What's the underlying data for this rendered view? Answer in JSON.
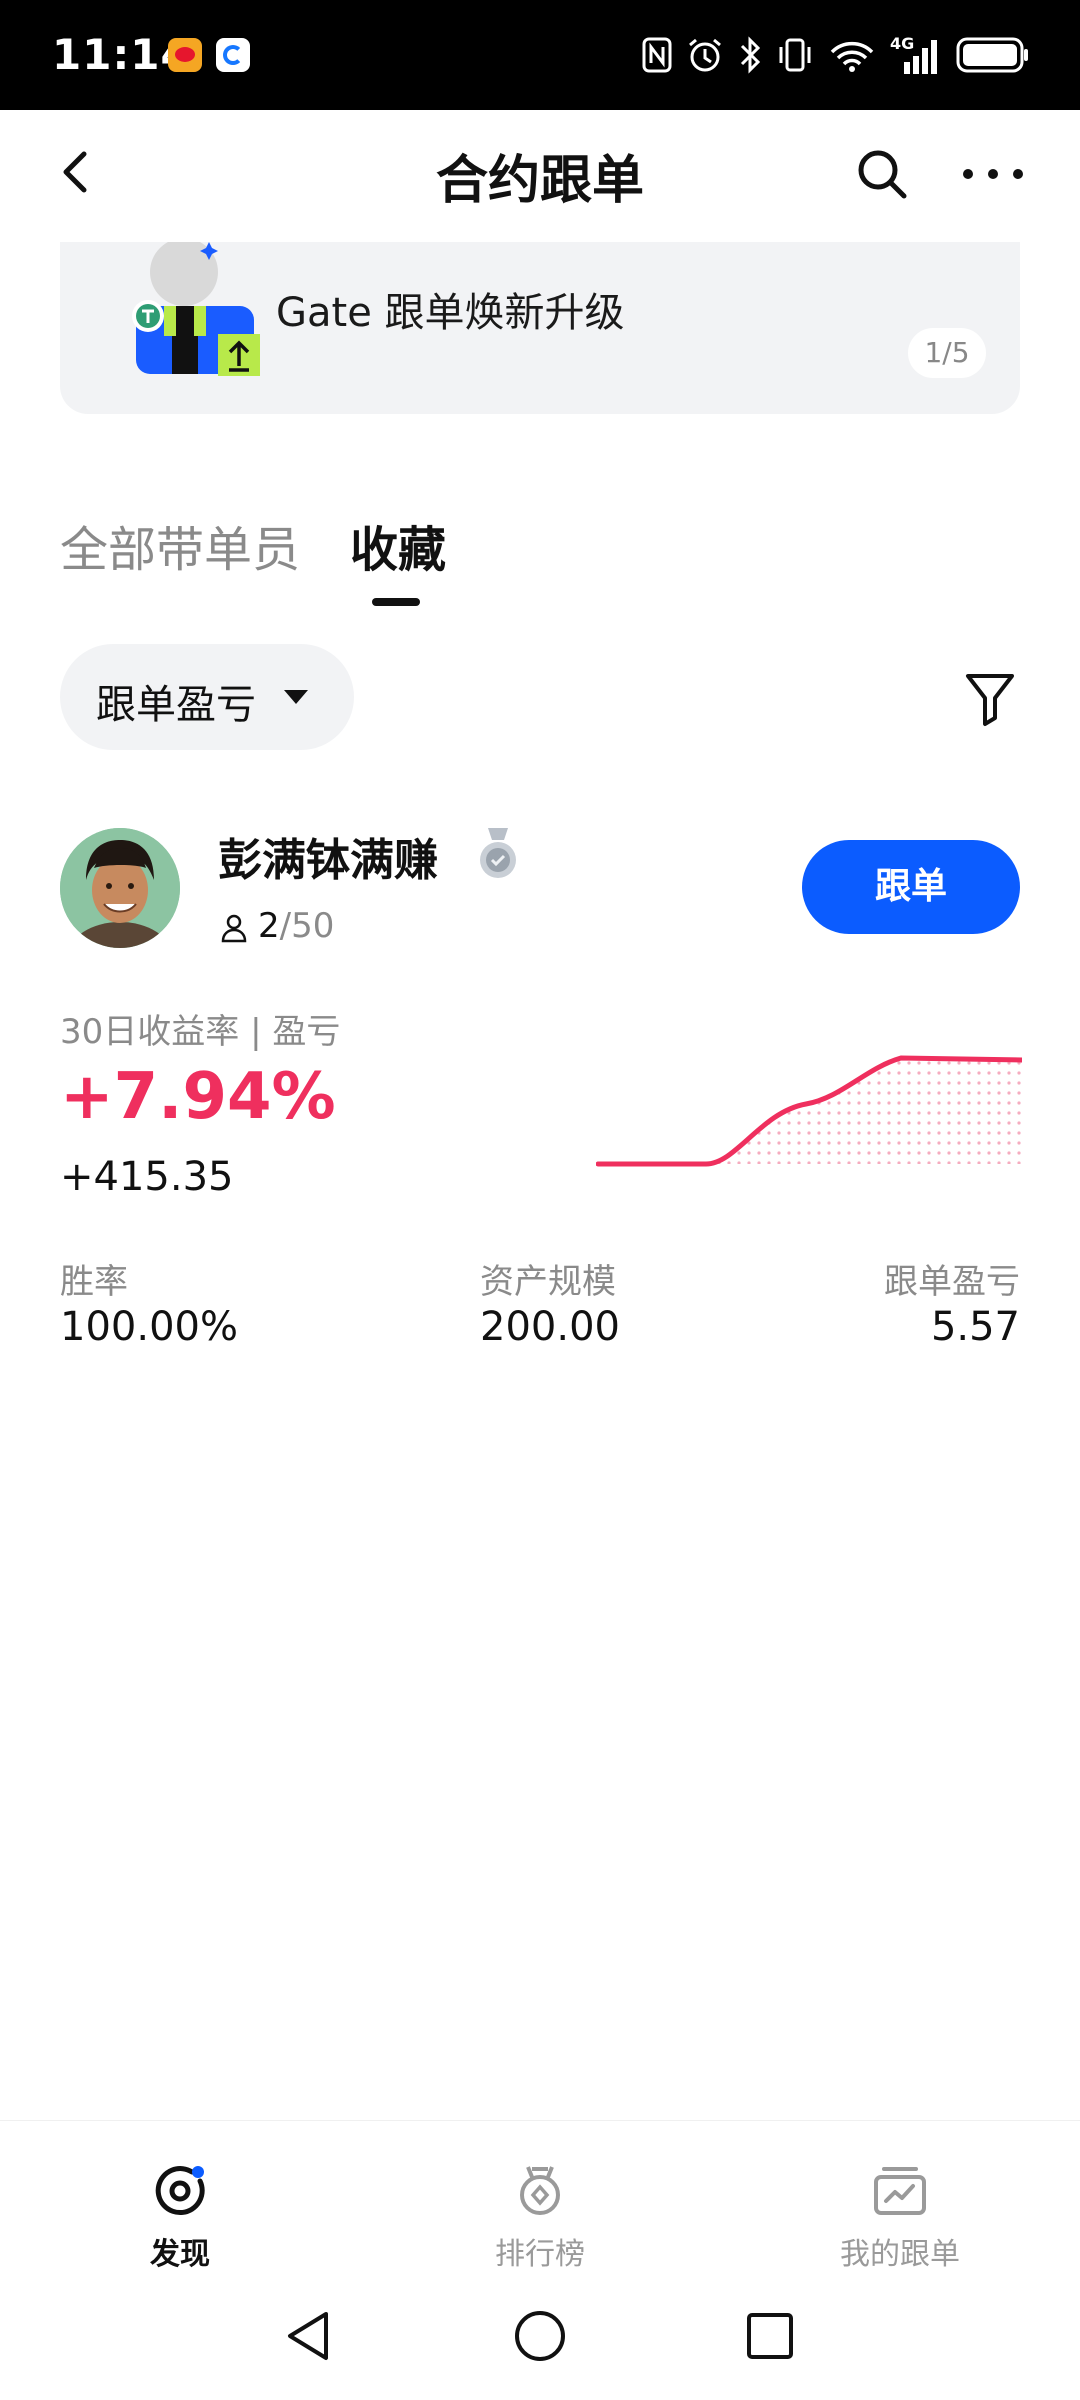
{
  "status_bar": {
    "time": "11:14",
    "network": "4G",
    "app_icons": [
      "weibo-icon",
      "app-notification-icon"
    ],
    "status_icons": [
      "nfc-icon",
      "alarm-icon",
      "bluetooth-icon",
      "vibrate-icon",
      "wifi-icon",
      "cellular-signal-icon",
      "battery-icon"
    ]
  },
  "header": {
    "title": "合约跟单",
    "back_icon": "chevron-left-icon",
    "search_icon": "search-icon",
    "more_icon": "more-icon"
  },
  "banner": {
    "text": "Gate 跟单焕新升级",
    "pager": "1/5"
  },
  "tabs": [
    {
      "label": "全部带单员",
      "active": false
    },
    {
      "label": "收藏",
      "active": true
    }
  ],
  "filter": {
    "sort_label": "跟单盈亏",
    "filter_icon": "filter-icon"
  },
  "trader": {
    "name": "彭满钵满赚",
    "followers_current": "2",
    "followers_max": "/50",
    "follow_label": "跟单",
    "roi_label": "30日收益率 | 盈亏",
    "roi_value": "+7.94%",
    "pnl_value": "+415.35",
    "stats": [
      {
        "label": "胜率",
        "value": "100.00%"
      },
      {
        "label": "资产规模",
        "value": "200.00"
      },
      {
        "label": "跟单盈亏",
        "value": "5.57"
      }
    ],
    "sparkline_color": "#ef2f5e"
  },
  "bottom_nav": [
    {
      "label": "发现",
      "icon": "discover-icon",
      "active": true
    },
    {
      "label": "排行榜",
      "icon": "ranking-medal-icon",
      "active": false
    },
    {
      "label": "我的跟单",
      "icon": "my-copy-trading-icon",
      "active": false
    }
  ],
  "colors": {
    "accent_blue": "#0b5cff",
    "profit_red": "#ef2f5e"
  }
}
